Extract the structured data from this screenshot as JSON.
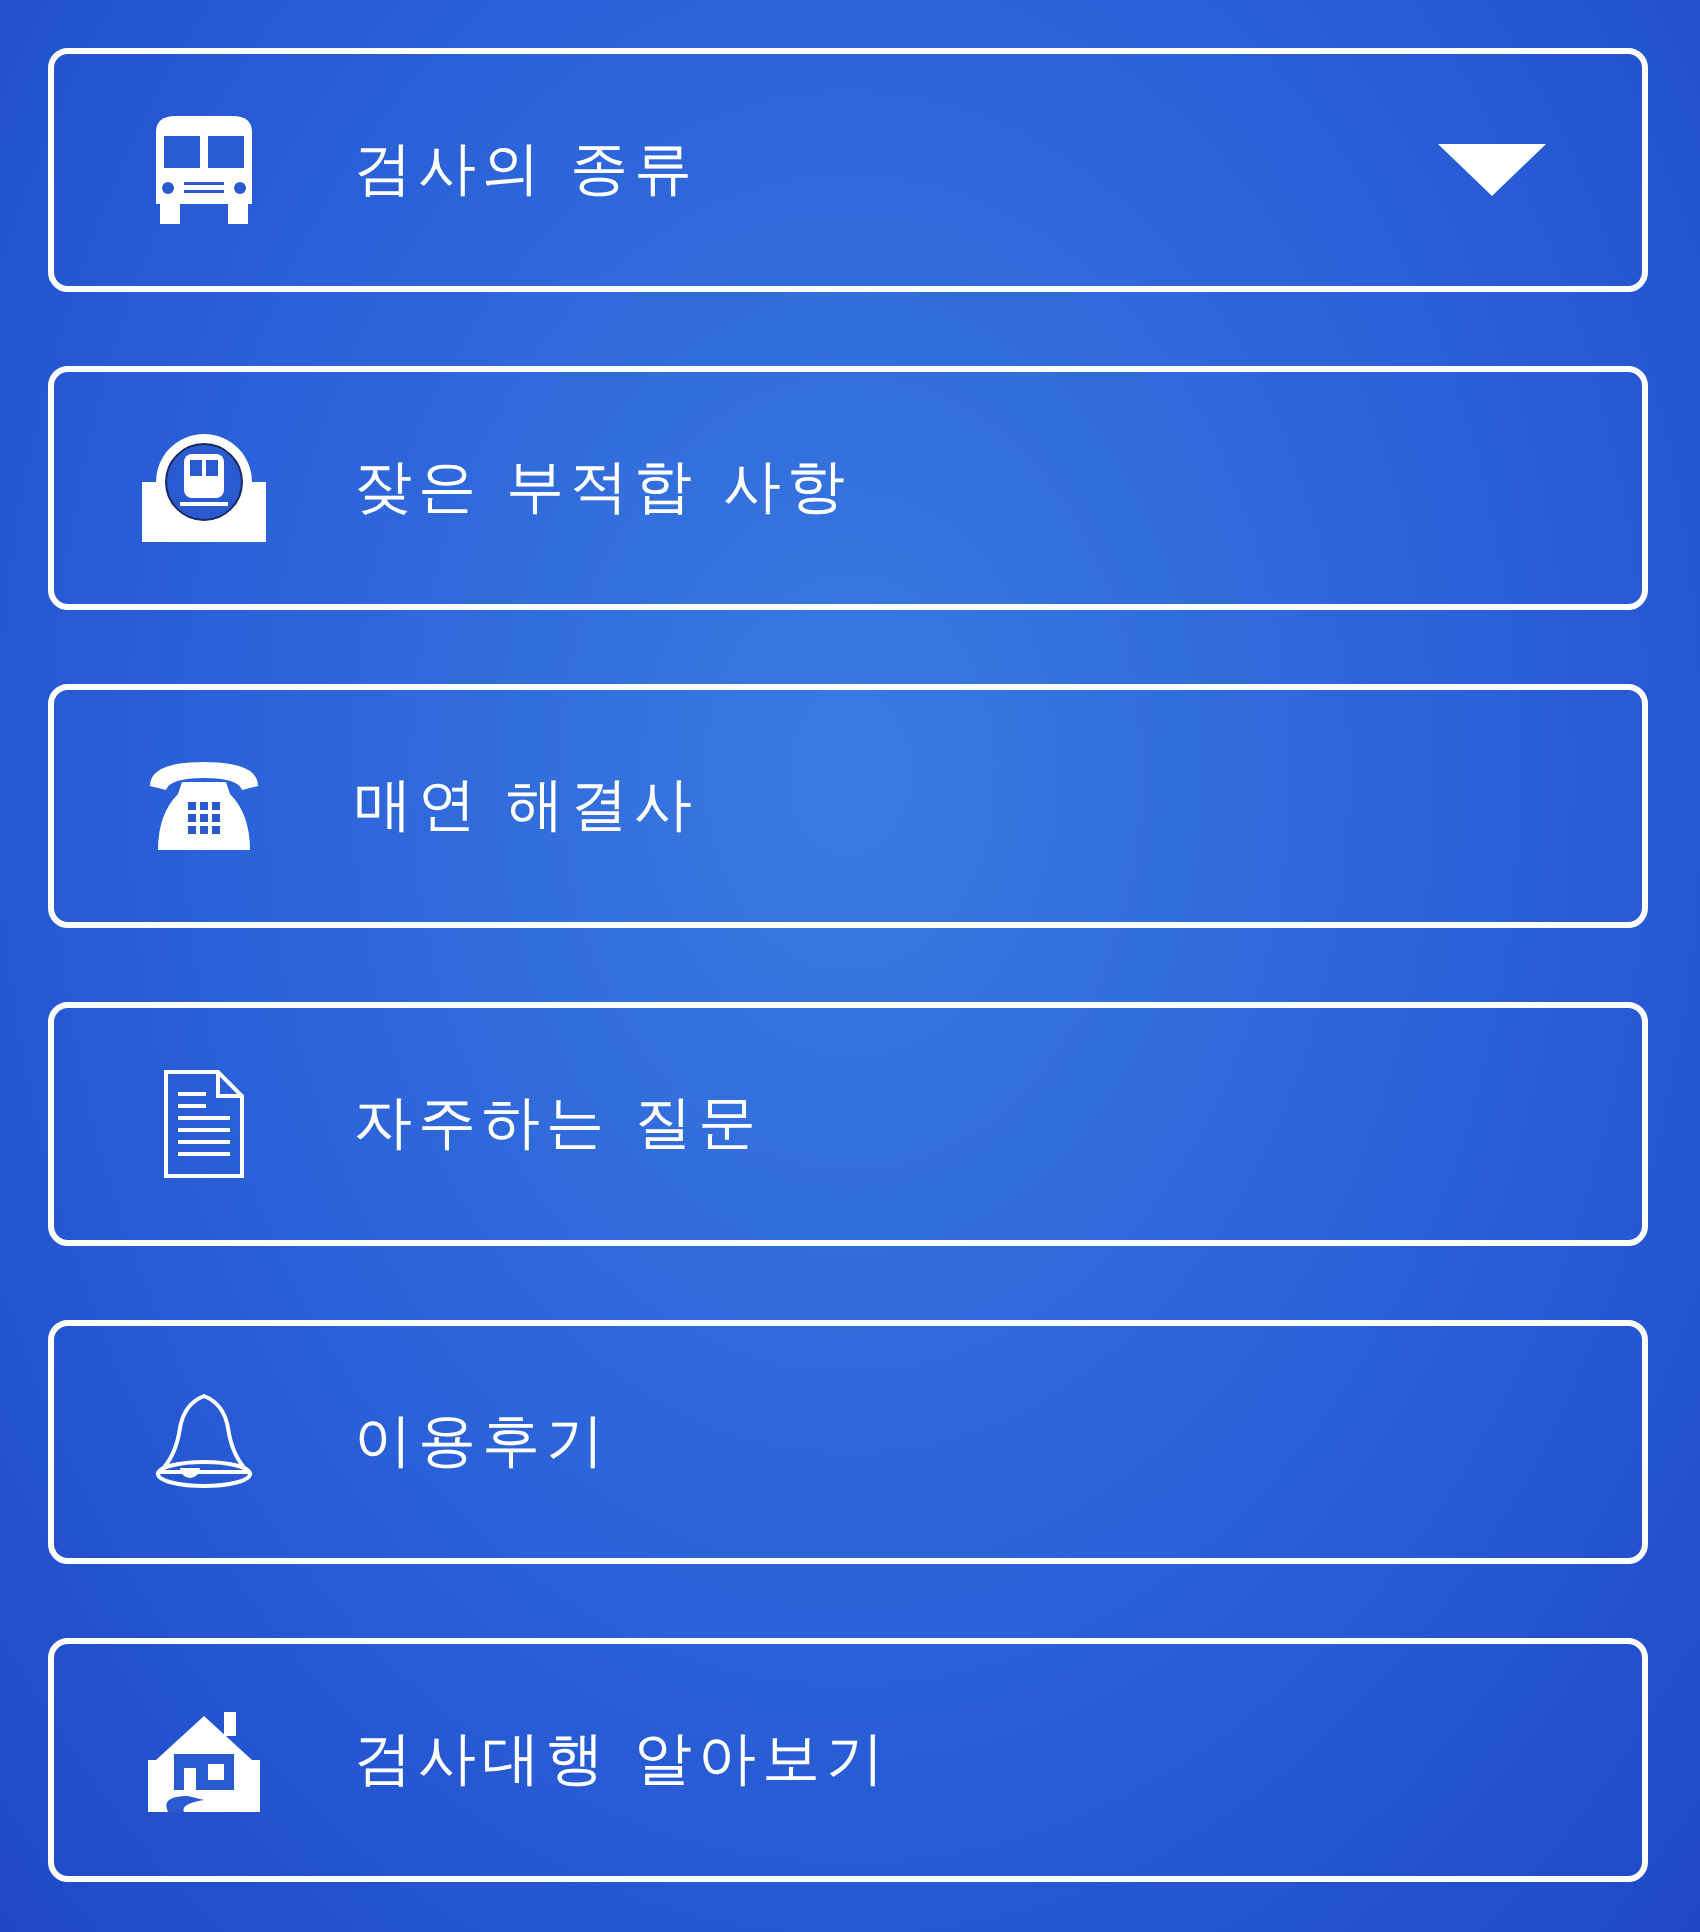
{
  "menu": [
    {
      "kind": "bus",
      "label": "검사의 종류",
      "dropdown": true
    },
    {
      "kind": "train-badge",
      "label": "잦은 부적합 사항",
      "dropdown": false
    },
    {
      "kind": "phone",
      "label": "매연 해결사",
      "dropdown": false
    },
    {
      "kind": "document",
      "label": "자주하는 질문",
      "dropdown": false
    },
    {
      "kind": "bell",
      "label": "이용후기",
      "dropdown": false
    },
    {
      "kind": "house",
      "label": "검사대행 알아보기",
      "dropdown": false
    }
  ]
}
